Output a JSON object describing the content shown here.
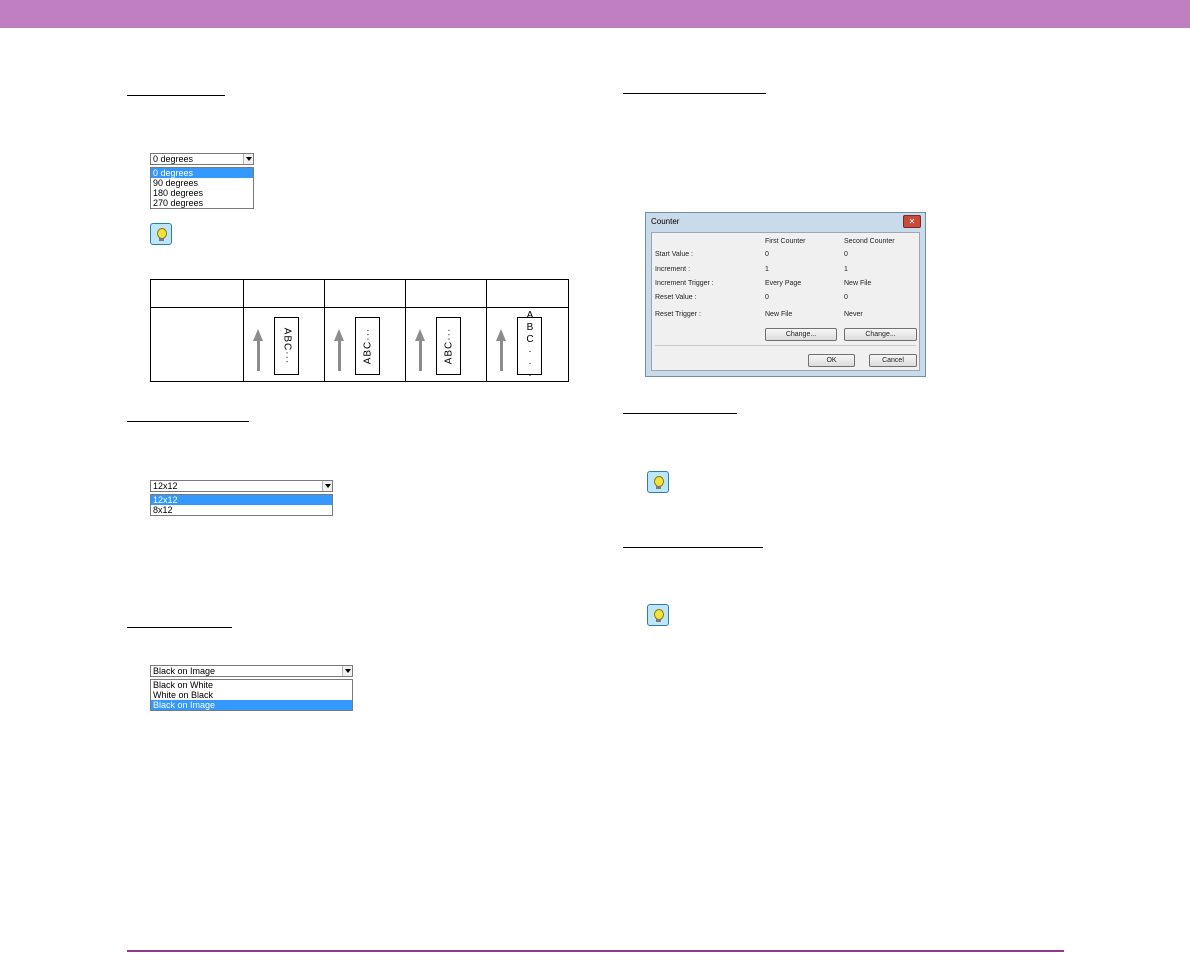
{
  "rotation_dropdown": {
    "selected": "0 degrees",
    "options": [
      "0 degrees",
      "90 degrees",
      "180 degrees",
      "270 degrees"
    ]
  },
  "orientation_table": {
    "pages": [
      {
        "text": "ABC···"
      },
      {
        "text": "ABC···"
      },
      {
        "text": "ABC···"
      },
      {
        "text": "ABC···"
      }
    ]
  },
  "size_dropdown": {
    "selected": "12x12",
    "options": [
      "12x12",
      "8x12"
    ]
  },
  "color_dropdown": {
    "selected": "Black on Image",
    "options": [
      "Black on White",
      "White on Black",
      "Black on Image"
    ]
  },
  "counter_dialog": {
    "title": "Counter",
    "close_glyph": "✕",
    "col_first": "First Counter",
    "col_second": "Second Counter",
    "rows": [
      {
        "label": "Start Value :",
        "first": "0",
        "second": "0"
      },
      {
        "label": "Increment :",
        "first": "1",
        "second": "1"
      },
      {
        "label": "Increment Trigger :",
        "first": "Every Page",
        "second": "New File"
      },
      {
        "label": "Reset Value :",
        "first": "0",
        "second": "0"
      },
      {
        "label": "Reset Trigger :",
        "first": "New File",
        "second": "Never"
      }
    ],
    "change_first": "Change...",
    "change_second": "Change...",
    "ok": "OK",
    "cancel": "Cancel"
  },
  "colors": {
    "top_bar": "#c07fc0",
    "bottom_line": "#8e3a8e",
    "selection": "#3399ff"
  },
  "icons": [
    "lightbulb-hint-icon",
    "up-arrow-icon",
    "dropdown-arrow-icon",
    "close-icon"
  ]
}
